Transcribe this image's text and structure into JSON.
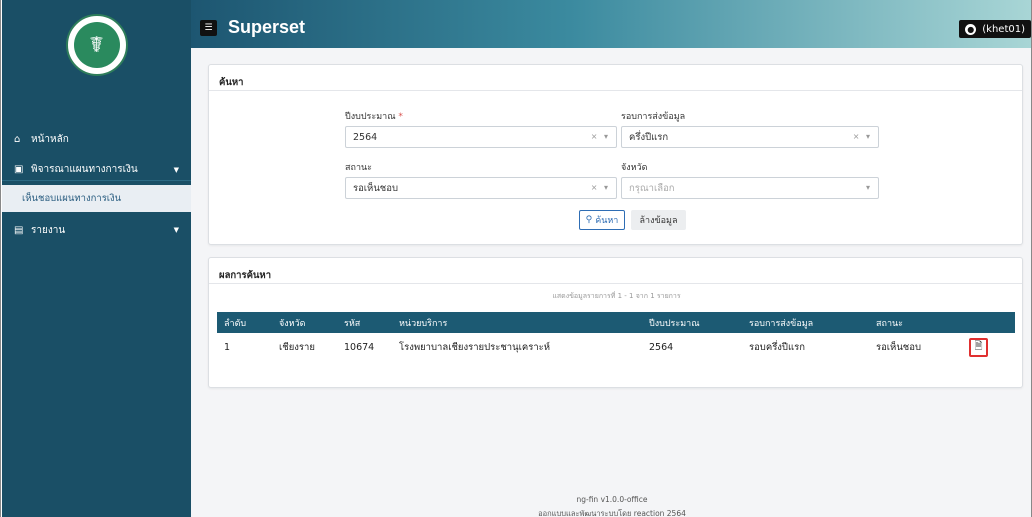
{
  "sidebar": {
    "logo_text": "MINISTRY OF PUBLIC HEALTH",
    "items": [
      {
        "label": "หน้าหลัก",
        "icon": "home-icon"
      },
      {
        "label": "พิจารณาแผนทางการเงิน",
        "icon": "clipboard-icon"
      },
      {
        "label": "เห็นชอบแผนทางการเงิน"
      },
      {
        "label": "รายงาน",
        "icon": "document-icon"
      }
    ]
  },
  "header": {
    "title": "Superset",
    "user": "(khet01)"
  },
  "search": {
    "heading": "ค้นหา",
    "fields": {
      "budget_year": {
        "label": "ปีงบประมาณ",
        "required_mark": "*",
        "value": "2564"
      },
      "submission_round": {
        "label": "รอบการส่งข้อมูล",
        "value": "ครึ่งปีแรก"
      },
      "status": {
        "label": "สถานะ",
        "value": "รอเห็นชอบ"
      },
      "province": {
        "label": "จังหวัด",
        "placeholder": "กรุณาเลือก"
      }
    },
    "search_button": "ค้นหา",
    "clear_button": "ล้างข้อมูล"
  },
  "results": {
    "heading": "ผลการค้นหา",
    "summary": "แสดงข้อมูลรายการที่ 1 - 1 จาก 1 รายการ",
    "columns": [
      "ลำดับ",
      "จังหวัด",
      "รหัส",
      "หน่วยบริการ",
      "ปีงบประมาณ",
      "รอบการส่งข้อมูล",
      "สถานะ",
      ""
    ],
    "rows": [
      [
        "1",
        "เชียงราย",
        "10674",
        "โรงพยาบาลเชียงรายประชานุเคราะห์",
        "2564",
        "รอบครึ่งปีแรก",
        "รอเห็นชอบ"
      ]
    ]
  },
  "footer": {
    "version": "ng-fin v1.0.0-office",
    "credit": "ออกแบบและพัฒนาระบบโดย reaction 2564"
  },
  "colors": {
    "sidebar": "#1a4f66",
    "table_header": "#1c5a73",
    "primary": "#2e6db4",
    "highlight": "#e03030"
  }
}
